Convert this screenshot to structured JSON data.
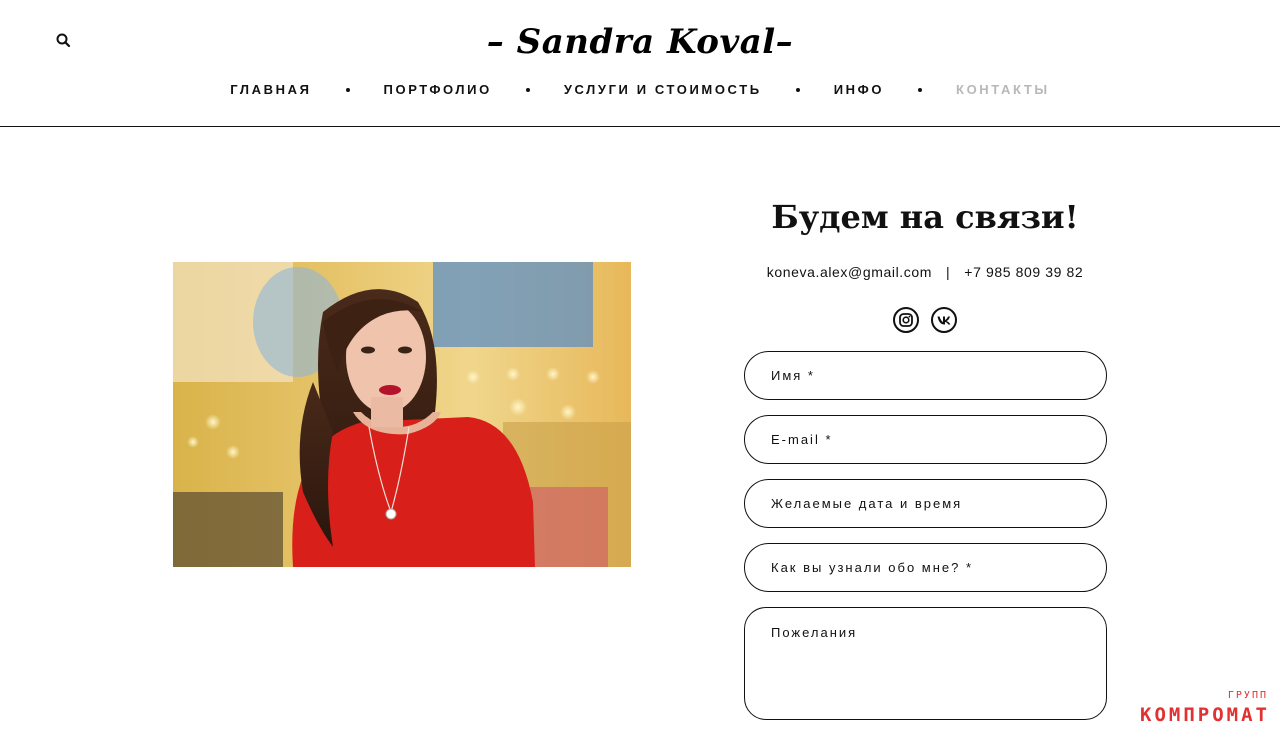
{
  "header": {
    "logo": "– Sandra Koval–",
    "search_icon": "search-icon",
    "nav": [
      {
        "label": "ГЛАВНАЯ",
        "active": false
      },
      {
        "label": "ПОРТФОЛИО",
        "active": false
      },
      {
        "label": "УСЛУГИ И СТОИМОСТЬ",
        "active": false
      },
      {
        "label": "ИНФО",
        "active": false
      },
      {
        "label": "КОНТАКТЫ",
        "active": true
      }
    ]
  },
  "contact": {
    "title": "Будем на связи!",
    "email": "koneva.alex@gmail.com",
    "separator": "|",
    "phone": "+7 985 809 39 82",
    "socials": [
      "instagram-icon",
      "vk-icon"
    ]
  },
  "form": {
    "name_placeholder": "Имя *",
    "email_placeholder": "E-mail *",
    "datetime_placeholder": "Желаемые дата и время",
    "source_placeholder": "Как вы узнали обо мне? *",
    "wishes_placeholder": "Пожелания"
  },
  "watermark": {
    "small": "ГРУПП",
    "main": "КОМПРОМАТ"
  },
  "colors": {
    "text": "#111111",
    "nav_active": "#b8b8b8",
    "watermark": "#e03232",
    "dress": "#d91f1a"
  }
}
